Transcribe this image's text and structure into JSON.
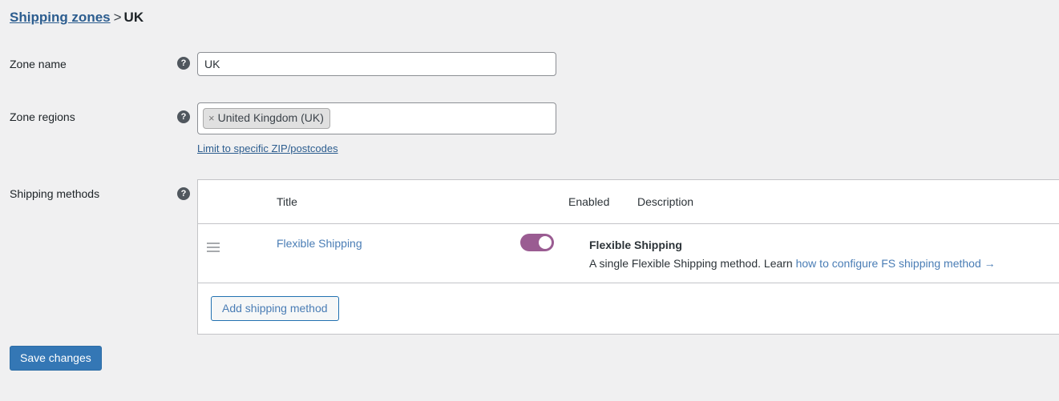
{
  "breadcrumb": {
    "parent_link": "Shipping zones",
    "separator": ">",
    "current": "UK"
  },
  "fields": {
    "zone_name": {
      "label": "Zone name",
      "help_icon": "help-icon",
      "value": "UK",
      "placeholder": ""
    },
    "zone_regions": {
      "label": "Zone regions",
      "help_icon": "help-icon",
      "chips": [
        {
          "remove_icon": "×",
          "label": "United Kingdom (UK)"
        }
      ],
      "limit_link": "Limit to specific ZIP/postcodes"
    },
    "shipping_methods": {
      "label": "Shipping methods",
      "help_icon": "help-icon"
    }
  },
  "methods_table": {
    "headers": {
      "title": "Title",
      "enabled": "Enabled",
      "description": "Description"
    },
    "rows": [
      {
        "handle_icon": "drag-handle-icon",
        "title": "Flexible Shipping",
        "enabled": true,
        "description_title": "Flexible Shipping",
        "description_text": "A single Flexible Shipping method. Learn ",
        "description_link": "how to configure FS shipping method →"
      }
    ],
    "add_button": "Add shipping method"
  },
  "actions": {
    "save_label": "Save changes"
  },
  "colors": {
    "page_background": "#f0f0f1",
    "link_blue": "#2c5d8f",
    "method_link_blue": "#4a7db5",
    "toggle_on": "#9a5c92",
    "primary_button": "#3477b5",
    "help_icon_bg": "#50575e",
    "border": "#c3c4c7"
  }
}
